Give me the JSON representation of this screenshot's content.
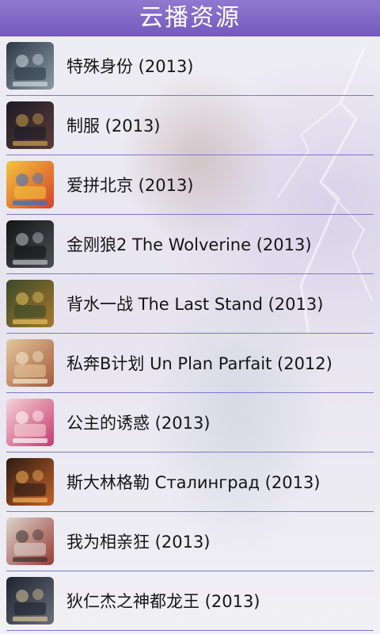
{
  "header": {
    "title": "云播资源"
  },
  "movies": [
    {
      "title": "特殊身份 (2013)",
      "poster": {
        "c1": "#2d3a45",
        "c2": "#8a9aa6",
        "accent": "#d0d8de"
      }
    },
    {
      "title": "制服 (2013)",
      "poster": {
        "c1": "#1b1c25",
        "c2": "#5c3b3a",
        "accent": "#c9a04b"
      }
    },
    {
      "title": "爱拼北京 (2013)",
      "poster": {
        "c1": "#f2c53a",
        "c2": "#d6402d",
        "accent": "#2f6fd0"
      }
    },
    {
      "title": "金刚狼2 The Wolverine (2013)",
      "poster": {
        "c1": "#141414",
        "c2": "#4a4f55",
        "accent": "#b9c0c7"
      }
    },
    {
      "title": "背水一战 The Last Stand (2013)",
      "poster": {
        "c1": "#3a4a2a",
        "c2": "#a7782e",
        "accent": "#e7c25b"
      }
    },
    {
      "title": "私奔B计划 Un Plan Parfait (2012)",
      "poster": {
        "c1": "#e2c79b",
        "c2": "#a55a3b",
        "accent": "#f4e9d4"
      }
    },
    {
      "title": "公主的诱惑 (2013)",
      "poster": {
        "c1": "#f5d2d8",
        "c2": "#c53b6e",
        "accent": "#ffffff"
      }
    },
    {
      "title": "斯大林格勒 Сталинград (2013)",
      "poster": {
        "c1": "#2c1b12",
        "c2": "#c4622a",
        "accent": "#f3b25a"
      }
    },
    {
      "title": "我为相亲狂 (2013)",
      "poster": {
        "c1": "#d9d4cc",
        "c2": "#9a3a35",
        "accent": "#3a2f2c"
      }
    },
    {
      "title": "狄仁杰之神都龙王 (2013)",
      "poster": {
        "c1": "#1c2430",
        "c2": "#6b6f78",
        "accent": "#d8c497"
      }
    }
  ]
}
